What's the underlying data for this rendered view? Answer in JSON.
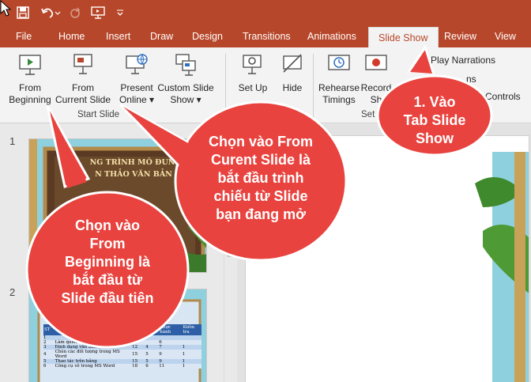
{
  "quick_access": {
    "save_icon": "save-icon",
    "undo_icon": "undo-icon",
    "redo_icon": "redo-icon",
    "from_beginning_icon": "slideshow-from-beginning-icon",
    "customize_icon": "chevron-down-icon"
  },
  "tabs": [
    {
      "label": "File"
    },
    {
      "label": "Home"
    },
    {
      "label": "Insert"
    },
    {
      "label": "Draw"
    },
    {
      "label": "Design"
    },
    {
      "label": "Transitions"
    },
    {
      "label": "Animations"
    },
    {
      "label": "Slide Show",
      "active": true
    },
    {
      "label": "Review"
    },
    {
      "label": "View"
    }
  ],
  "ribbon": {
    "from_beginning": {
      "line1": "From",
      "line2": "Beginning"
    },
    "from_current": {
      "line1": "From",
      "line2": "Current Slide"
    },
    "present_online": {
      "line1": "Present",
      "line2": "Online ▾"
    },
    "custom_slide_show": {
      "line1": "Custom Slide",
      "line2": "Show ▾"
    },
    "group_start": "Start Slide",
    "setup": {
      "line1": "Set Up",
      "line2": ""
    },
    "hide": {
      "line1": "Hide",
      "line2": ""
    },
    "rehearse": {
      "line1": "Rehearse",
      "line2": "Timings"
    },
    "record": {
      "line1": "Record",
      "line2": "Sh"
    },
    "group_set": "Set",
    "play_narrations": "Play Narrations",
    "use_timings_fragment": "ns",
    "show_controls_fragment": "Controls"
  },
  "slides": {
    "numbers": [
      "1",
      "2"
    ],
    "slide1_title_fragments": [
      "NG TRÌNH MÔ ĐUN ĐÀ",
      "N THẢO VĂN BẢN ĐI"
    ],
    "slide2_title_fragment": "ĂN",
    "slide2_headers": [
      "ST",
      "Thực hành",
      "Kiểm tra"
    ],
    "slide2_rows": [
      [
        "1",
        "",
        "",
        "",
        "",
        ""
      ],
      [
        "2",
        "Làm quen với Microsoft Word",
        "3",
        "",
        "6",
        ""
      ],
      [
        "3",
        "Định dạng văn bản",
        "12",
        "4",
        "7",
        "1"
      ],
      [
        "4",
        "Chèn các đối tượng trong MS Word",
        "15",
        "5",
        "9",
        "1"
      ],
      [
        "5",
        "Thao tác trên bảng",
        "15",
        "5",
        "9",
        "1"
      ],
      [
        "6",
        "Công cụ vẽ trong MS Word",
        "18",
        "6",
        "11",
        "1"
      ]
    ]
  },
  "callouts": {
    "tab": "1. Vào\nTab Slide\nShow",
    "from_current": "Chọn vào From\nCurent Slide là\nbắt đầu trình\nchiếu từ Slide\nbạn đang mở",
    "from_beginning": "Chọn vào\nFrom\nBeginning là\nbắt đầu từ\nSlide đầu tiên"
  },
  "colors": {
    "accent": "#b7472a",
    "callout": "#e8433f",
    "ribbon_bg": "#f3f3f3"
  }
}
